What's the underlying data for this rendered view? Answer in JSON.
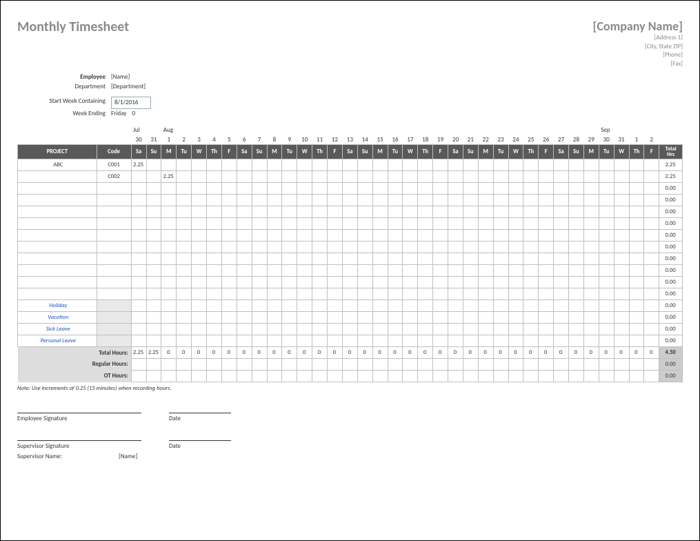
{
  "title": "Monthly Timesheet",
  "company": {
    "name": "[Company Name]",
    "address1": "[Address 1]",
    "address2": "[City, State ZIP]",
    "phone": "[Phone]",
    "fax": "[Fax]"
  },
  "employee": {
    "label": "Employee",
    "value": "[Name]",
    "dept_label": "Department",
    "dept_value": "[Department]"
  },
  "period": {
    "start_label": "Start Week Containing",
    "start_value": "8/1/2016",
    "end_label": "Week Ending",
    "end_day": "Friday",
    "end_num": "0"
  },
  "months": {
    "jul": "Jul",
    "aug": "Aug",
    "sep": "Sep"
  },
  "date_numbers": [
    "30",
    "31",
    "1",
    "2",
    "3",
    "4",
    "5",
    "6",
    "7",
    "8",
    "9",
    "10",
    "11",
    "12",
    "13",
    "14",
    "15",
    "16",
    "17",
    "18",
    "19",
    "20",
    "21",
    "22",
    "23",
    "24",
    "25",
    "26",
    "27",
    "28",
    "29",
    "30",
    "31",
    "1",
    "2"
  ],
  "dow": [
    "Sa",
    "Su",
    "M",
    "Tu",
    "W",
    "Th",
    "F",
    "Sa",
    "Su",
    "M",
    "Tu",
    "W",
    "Th",
    "F",
    "Sa",
    "Su",
    "M",
    "Tu",
    "W",
    "Th",
    "F",
    "Sa",
    "Su",
    "M",
    "Tu",
    "W",
    "Th",
    "F",
    "Sa",
    "Su",
    "M",
    "Tu",
    "W",
    "Th",
    "F"
  ],
  "headers": {
    "project": "PROJECT",
    "code": "Code",
    "total": "Total Hrs"
  },
  "rows": [
    {
      "project": "ABC",
      "code": "C001",
      "hours": {
        "0": "2.25"
      },
      "total": "2.25"
    },
    {
      "project": "",
      "code": "C002",
      "hours": {
        "2": "2.25"
      },
      "total": "2.25"
    },
    {
      "project": "",
      "code": "",
      "hours": {},
      "total": "0.00"
    },
    {
      "project": "",
      "code": "",
      "hours": {},
      "total": "0.00"
    },
    {
      "project": "",
      "code": "",
      "hours": {},
      "total": "0.00"
    },
    {
      "project": "",
      "code": "",
      "hours": {},
      "total": "0.00"
    },
    {
      "project": "",
      "code": "",
      "hours": {},
      "total": "0.00"
    },
    {
      "project": "",
      "code": "",
      "hours": {},
      "total": "0.00"
    },
    {
      "project": "",
      "code": "",
      "hours": {},
      "total": "0.00"
    },
    {
      "project": "",
      "code": "",
      "hours": {},
      "total": "0.00"
    },
    {
      "project": "",
      "code": "",
      "hours": {},
      "total": "0.00"
    },
    {
      "project": "",
      "code": "",
      "hours": {},
      "total": "0.00"
    }
  ],
  "special_rows": [
    {
      "label": "Holiday",
      "total": "0.00"
    },
    {
      "label": "Vacation",
      "total": "0.00"
    },
    {
      "label": "Sick Leave",
      "total": "0.00"
    },
    {
      "label": "Personal Leave",
      "total": "0.00"
    }
  ],
  "totals": {
    "label": "Total Hours:",
    "per_day": [
      "2.25",
      "2.25",
      "0",
      "0",
      "0",
      "0",
      "0",
      "0",
      "0",
      "0",
      "0",
      "0",
      "0",
      "0",
      "0",
      "0",
      "0",
      "0",
      "0",
      "0",
      "0",
      "0",
      "0",
      "0",
      "0",
      "0",
      "0",
      "0",
      "0",
      "0",
      "0",
      "0",
      "0",
      "0",
      "0"
    ],
    "grand": "4.50",
    "reg_label": "Regular Hours:",
    "reg_total": "0.00",
    "ot_label": "OT Hours:",
    "ot_total": "0.00"
  },
  "note": "Note: Use increments of 0.25 (15 minutes) when recording hours.",
  "sig": {
    "emp": "Employee Signature",
    "sup": "Supervisor Signature",
    "date": "Date",
    "sup_name_label": "Supervisor Name:",
    "sup_name": "[Name]"
  }
}
